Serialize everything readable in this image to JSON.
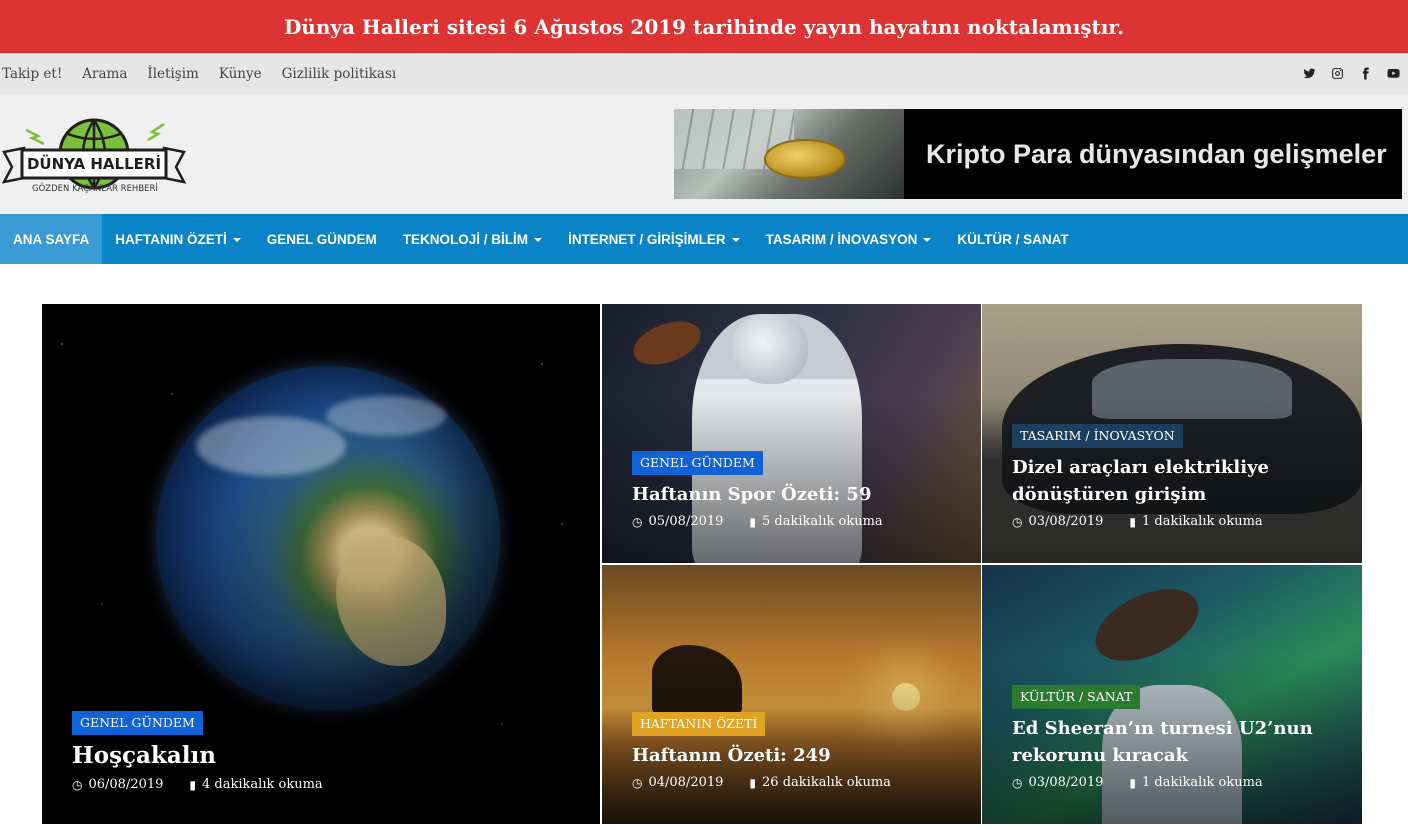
{
  "announcement": "Dünya Halleri sitesi 6 Ağustos 2019 tarihinde yayın hayatını noktalamıştır.",
  "top_links": [
    "Takip et!",
    "Arama",
    "İletişim",
    "Künye",
    "Gizlilik politikası"
  ],
  "social_icons": [
    "twitter-icon",
    "instagram-icon",
    "facebook-icon",
    "youtube-icon"
  ],
  "logo": {
    "name": "DÜNYA HALLERİ",
    "tagline": "GÖZDEN KAÇANLAR REHBERİ"
  },
  "ad": {
    "text": "Kripto Para dünyasından gelişmeler"
  },
  "nav": [
    {
      "label": "ANA SAYFA",
      "active": true,
      "dropdown": false
    },
    {
      "label": "HAFTANIN ÖZETİ",
      "active": false,
      "dropdown": true
    },
    {
      "label": "GENEL GÜNDEM",
      "active": false,
      "dropdown": false
    },
    {
      "label": "TEKNOLOJİ / BİLİM",
      "active": false,
      "dropdown": true
    },
    {
      "label": "İNTERNET / GİRİŞİMLER",
      "active": false,
      "dropdown": true
    },
    {
      "label": "TASARIM / İNOVASYON",
      "active": false,
      "dropdown": true
    },
    {
      "label": "KÜLTÜR / SANAT",
      "active": false,
      "dropdown": false
    }
  ],
  "posts": [
    {
      "category": "GENEL GÜNDEM",
      "title": "Hoşçakalın",
      "date": "06/08/2019",
      "read": "4 dakikalık okuma"
    },
    {
      "category": "GENEL GÜNDEM",
      "title": "Haftanın Spor Özeti: 59",
      "date": "05/08/2019",
      "read": "5 dakikalık okuma"
    },
    {
      "category": "TASARIM / İNOVASYON",
      "title": "Dizel araçları elektrikliye dönüştüren girişim",
      "date": "03/08/2019",
      "read": "1 dakikalık okuma"
    },
    {
      "category": "HAFTANIN ÖZETİ",
      "title": "Haftanın Özeti: 249",
      "date": "04/08/2019",
      "read": "26 dakikalık okuma"
    },
    {
      "category": "KÜLTÜR / SANAT",
      "title": "Ed Sheeran’ın turnesi U2’nun rekorunu kıracak",
      "date": "03/08/2019",
      "read": "1 dakikalık okuma"
    }
  ],
  "colors": {
    "announce": "#dd3333",
    "nav": "#0b84c7",
    "badge_blue": "#1063d6",
    "badge_navy": "#1d3f5e",
    "badge_yellow": "#e0a323",
    "badge_green": "#2a7a2f"
  }
}
